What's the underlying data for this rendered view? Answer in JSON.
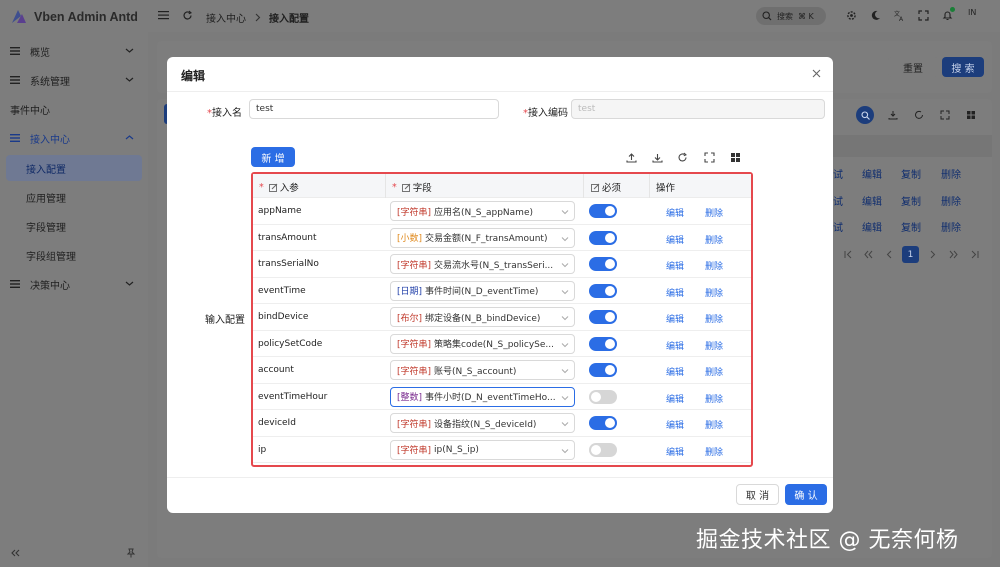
{
  "app": {
    "title": "Vben Admin Antd"
  },
  "sidebar": {
    "items": [
      {
        "label": "概览",
        "has_icon": true,
        "chevron": true
      },
      {
        "label": "系统管理",
        "has_icon": true,
        "chevron": true
      },
      {
        "label": "事件中心",
        "has_icon": false,
        "chevron": false
      },
      {
        "label": "接入中心",
        "has_icon": true,
        "chevron": true
      },
      {
        "label": "接入配置"
      },
      {
        "label": "应用管理"
      },
      {
        "label": "字段管理"
      },
      {
        "label": "字段组管理"
      },
      {
        "label": "决策中心",
        "has_icon": true,
        "chevron": true
      }
    ],
    "collapse_icon": "double-chevron-left-icon",
    "pin_icon": "pin-icon"
  },
  "header": {
    "breadcrumb": [
      "接入中心",
      "接入配置"
    ],
    "search_placeholder": "搜索",
    "search_shortcut": "⌘ K",
    "avatar": "IN"
  },
  "background": {
    "reset_label": "重置",
    "search_label": "搜 索",
    "row_actions": [
      {
        "prefix": "试",
        "edit": "编辑",
        "copy": "复制",
        "delete": "删除"
      },
      {
        "prefix": "试",
        "edit": "编辑",
        "copy": "复制",
        "delete": "删除"
      },
      {
        "prefix": "试",
        "edit": "编辑",
        "copy": "复制",
        "delete": "删除"
      }
    ],
    "page": "1"
  },
  "modal": {
    "title": "编辑",
    "fields": {
      "name_label": "接入名",
      "name_value": "test",
      "code_label": "接入编码",
      "code_value": "test",
      "input_config_label": "输入配置"
    },
    "add_label": "新 增",
    "grid": {
      "headers": {
        "param": "入参",
        "field": "字段",
        "required": "必须",
        "actions": "操作"
      },
      "rows": [
        {
          "param": "appName",
          "type": "[字符串]",
          "type_color": "#c0392b",
          "field": "应用名(N_S_appName)",
          "required": true,
          "focus": false
        },
        {
          "param": "transAmount",
          "type": "[小数]",
          "type_color": "#e08a1e",
          "field": "交易金额(N_F_transAmount)",
          "required": true,
          "focus": false
        },
        {
          "param": "transSerialNo",
          "type": "[字符串]",
          "type_color": "#c0392b",
          "field": "交易流水号(N_S_transSeri...",
          "required": true,
          "focus": false
        },
        {
          "param": "eventTime",
          "type": "[日期]",
          "type_color": "#1f3ea8",
          "field": "事件时间(N_D_eventTime)",
          "required": true,
          "focus": false
        },
        {
          "param": "bindDevice",
          "type": "[布尔]",
          "type_color": "#c0392b",
          "field": "绑定设备(N_B_bindDevice)",
          "required": true,
          "focus": false
        },
        {
          "param": "policySetCode",
          "type": "[字符串]",
          "type_color": "#c0392b",
          "field": "策略集code(N_S_policySe...",
          "required": true,
          "focus": false
        },
        {
          "param": "account",
          "type": "[字符串]",
          "type_color": "#c0392b",
          "field": "账号(N_S_account)",
          "required": true,
          "focus": false
        },
        {
          "param": "eventTimeHour",
          "type": "[整数]",
          "type_color": "#7a2b8f",
          "field": "事件小时(D_N_eventTimeHo...",
          "required": false,
          "focus": true
        },
        {
          "param": "deviceId",
          "type": "[字符串]",
          "type_color": "#c0392b",
          "field": "设备指纹(N_S_deviceId)",
          "required": true,
          "focus": false
        },
        {
          "param": "ip",
          "type": "[字符串]",
          "type_color": "#c0392b",
          "field": "ip(N_S_ip)",
          "required": false,
          "focus": false
        }
      ],
      "edit_label": "编辑",
      "delete_label": "删除"
    },
    "cancel_label": "取 消",
    "ok_label": "确 认"
  },
  "watermark": "掘金技术社区 @ 无奈何杨",
  "colors": {
    "primary": "#2b6de5",
    "danger": "#e5484d",
    "overlay": "#7b7b7b"
  }
}
